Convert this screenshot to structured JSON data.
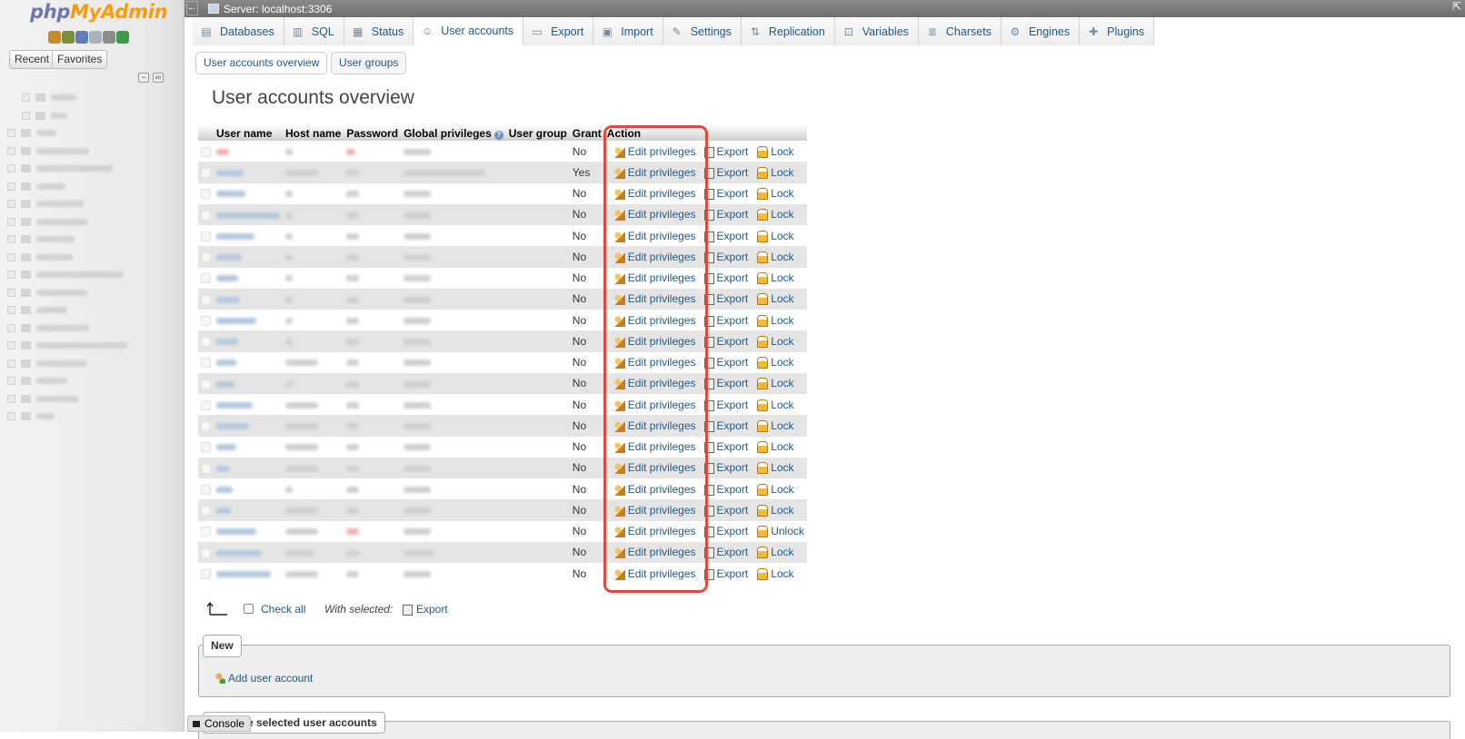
{
  "nav": {
    "logo_php": "php",
    "logo_my": "MyAdmin",
    "icons": [
      {
        "name": "home-icon",
        "color": "#c98a2e"
      },
      {
        "name": "exit-icon",
        "color": "#7b8f3a"
      },
      {
        "name": "help-icon",
        "color": "#5f7fb6"
      },
      {
        "name": "docs-icon",
        "color": "#aab3bd"
      },
      {
        "name": "settings-icon",
        "color": "#8c8c8c"
      },
      {
        "name": "reload-icon",
        "color": "#3d9a48"
      }
    ],
    "recent_label": "Recent",
    "favorites_label": "Favorites",
    "collapse_icon": "−",
    "link_icon": "∞"
  },
  "topbar": {
    "back_icon": "←",
    "server_label": "Server: localhost:3306",
    "collapse_icon": "⇱"
  },
  "tabs": [
    {
      "label": "Databases",
      "icon": "database-icon",
      "glyph": "▤"
    },
    {
      "label": "SQL",
      "icon": "sql-icon",
      "glyph": "▥"
    },
    {
      "label": "Status",
      "icon": "status-icon",
      "glyph": "▦"
    },
    {
      "label": "User accounts",
      "icon": "users-icon",
      "glyph": "☺",
      "active": true
    },
    {
      "label": "Export",
      "icon": "export-icon",
      "glyph": "▭"
    },
    {
      "label": "Import",
      "icon": "import-icon",
      "glyph": "▣"
    },
    {
      "label": "Settings",
      "icon": "wrench-icon",
      "glyph": "✎"
    },
    {
      "label": "Replication",
      "icon": "replication-icon",
      "glyph": "⇅"
    },
    {
      "label": "Variables",
      "icon": "variables-icon",
      "glyph": "⊡"
    },
    {
      "label": "Charsets",
      "icon": "charsets-icon",
      "glyph": "≣"
    },
    {
      "label": "Engines",
      "icon": "engines-icon",
      "glyph": "⚙"
    },
    {
      "label": "Plugins",
      "icon": "plugins-icon",
      "glyph": "✚"
    }
  ],
  "subtabs": {
    "overview": "User accounts overview",
    "groups": "User groups"
  },
  "page_title": "User accounts overview",
  "table": {
    "headers": {
      "user": "User name",
      "host": "Host name",
      "password": "Password",
      "global": "Global privileges",
      "group": "User group",
      "grant": "Grant",
      "action": "Action"
    },
    "action_labels": {
      "edit": "Edit privileges",
      "export": "Export"
    },
    "rows": [
      {
        "grant": "No",
        "lock": "Lock",
        "user_red": true
      },
      {
        "grant": "Yes",
        "lock": "Lock"
      },
      {
        "grant": "No",
        "lock": "Lock"
      },
      {
        "grant": "No",
        "lock": "Lock"
      },
      {
        "grant": "No",
        "lock": "Lock"
      },
      {
        "grant": "No",
        "lock": "Lock"
      },
      {
        "grant": "No",
        "lock": "Lock"
      },
      {
        "grant": "No",
        "lock": "Lock"
      },
      {
        "grant": "No",
        "lock": "Lock"
      },
      {
        "grant": "No",
        "lock": "Lock"
      },
      {
        "grant": "No",
        "lock": "Lock"
      },
      {
        "grant": "No",
        "lock": "Lock"
      },
      {
        "grant": "No",
        "lock": "Lock"
      },
      {
        "grant": "No",
        "lock": "Lock"
      },
      {
        "grant": "No",
        "lock": "Lock"
      },
      {
        "grant": "No",
        "lock": "Lock"
      },
      {
        "grant": "No",
        "lock": "Lock"
      },
      {
        "grant": "No",
        "lock": "Lock"
      },
      {
        "grant": "No",
        "lock": "Unlock",
        "password_red": true
      },
      {
        "grant": "No",
        "lock": "Lock"
      },
      {
        "grant": "No",
        "lock": "Lock"
      }
    ]
  },
  "footer": {
    "check_all": "Check all",
    "with_selected": "With selected:",
    "export_label": "Export",
    "new_legend": "New",
    "add_user": "Add user account",
    "remove_legend": "Remove selected user accounts",
    "console": "Console"
  },
  "colors": {
    "link": "#235a81",
    "highlight": "#e04a3c",
    "logo_blue": "#6c78af",
    "logo_orange": "#f89c0e"
  }
}
